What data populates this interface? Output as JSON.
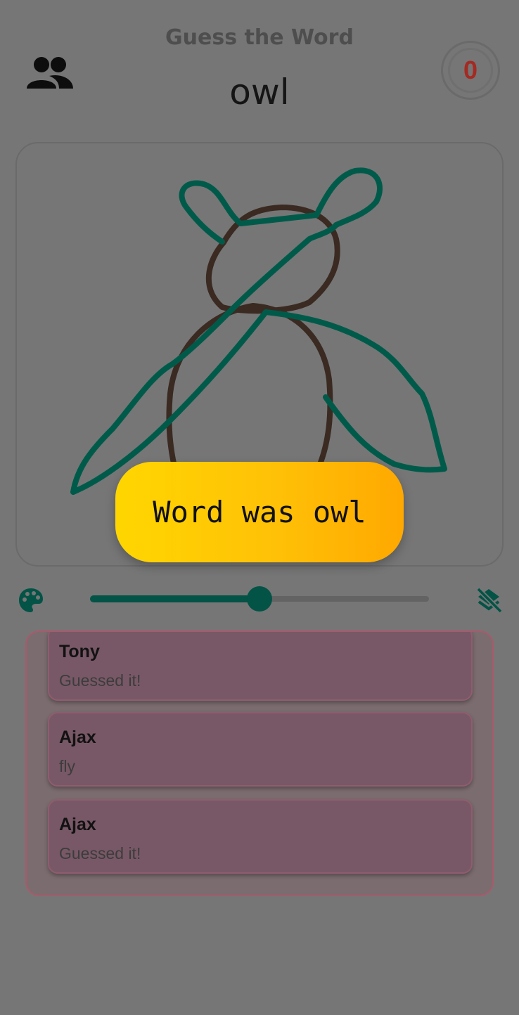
{
  "header": {
    "title": "Guess the Word",
    "word": "owl",
    "players_icon": "people-icon",
    "score": "0",
    "score_color": "#a42a22"
  },
  "canvas": {
    "stroke_colors": [
      "#3a2a22",
      "#005a4a"
    ]
  },
  "toast": {
    "text": "Word was owl",
    "colors": [
      "#ffd600",
      "#ffa800"
    ]
  },
  "toolbar": {
    "palette_icon": "palette-icon",
    "clear_icon": "layers-clear-icon",
    "stroke_width_fraction": 0.5,
    "accent": "#035346"
  },
  "chat": {
    "messages": [
      {
        "name": "Tony",
        "text": "Guessed it!"
      },
      {
        "name": "Ajax",
        "text": "fly"
      },
      {
        "name": "Ajax",
        "text": "Guessed it!"
      }
    ]
  }
}
